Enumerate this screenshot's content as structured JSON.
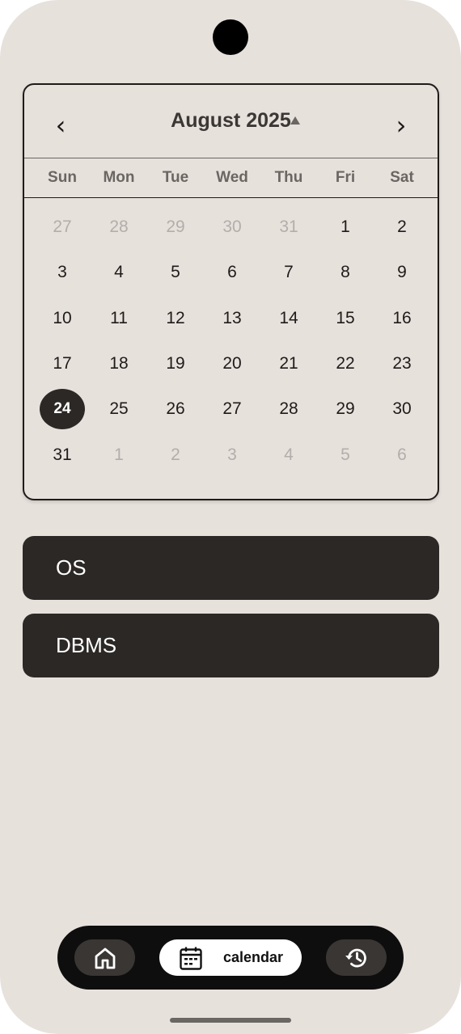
{
  "calendar": {
    "month_label": "August 2025",
    "prev_icon": "‹",
    "next_icon": "›",
    "weekdays": [
      "Sun",
      "Mon",
      "Tue",
      "Wed",
      "Thu",
      "Fri",
      "Sat"
    ],
    "weeks": [
      [
        {
          "d": "27",
          "muted": true
        },
        {
          "d": "28",
          "muted": true
        },
        {
          "d": "29",
          "muted": true
        },
        {
          "d": "30",
          "muted": true
        },
        {
          "d": "31",
          "muted": true
        },
        {
          "d": "1"
        },
        {
          "d": "2"
        }
      ],
      [
        {
          "d": "3"
        },
        {
          "d": "4"
        },
        {
          "d": "5"
        },
        {
          "d": "6"
        },
        {
          "d": "7"
        },
        {
          "d": "8"
        },
        {
          "d": "9"
        }
      ],
      [
        {
          "d": "10"
        },
        {
          "d": "11"
        },
        {
          "d": "12"
        },
        {
          "d": "13"
        },
        {
          "d": "14"
        },
        {
          "d": "15"
        },
        {
          "d": "16"
        }
      ],
      [
        {
          "d": "17"
        },
        {
          "d": "18"
        },
        {
          "d": "19"
        },
        {
          "d": "20"
        },
        {
          "d": "21"
        },
        {
          "d": "22"
        },
        {
          "d": "23"
        }
      ],
      [
        {
          "d": "24",
          "selected": true
        },
        {
          "d": "25"
        },
        {
          "d": "26"
        },
        {
          "d": "27"
        },
        {
          "d": "28"
        },
        {
          "d": "29"
        },
        {
          "d": "30"
        }
      ],
      [
        {
          "d": "31"
        },
        {
          "d": "1",
          "muted": true
        },
        {
          "d": "2",
          "muted": true
        },
        {
          "d": "3",
          "muted": true
        },
        {
          "d": "4",
          "muted": true
        },
        {
          "d": "5",
          "muted": true
        },
        {
          "d": "6",
          "muted": true
        }
      ]
    ]
  },
  "subjects": [
    {
      "label": "OS"
    },
    {
      "label": "DBMS"
    }
  ],
  "bottom_nav": {
    "home_icon": "home-icon",
    "calendar_icon": "calendar-icon",
    "calendar_label": "calendar",
    "history_icon": "history-icon"
  },
  "colors": {
    "background": "#e7e1dc",
    "card_dark": "#2c2826",
    "nav_bar": "#0f0e0e",
    "muted_text": "#b3aeaa"
  }
}
